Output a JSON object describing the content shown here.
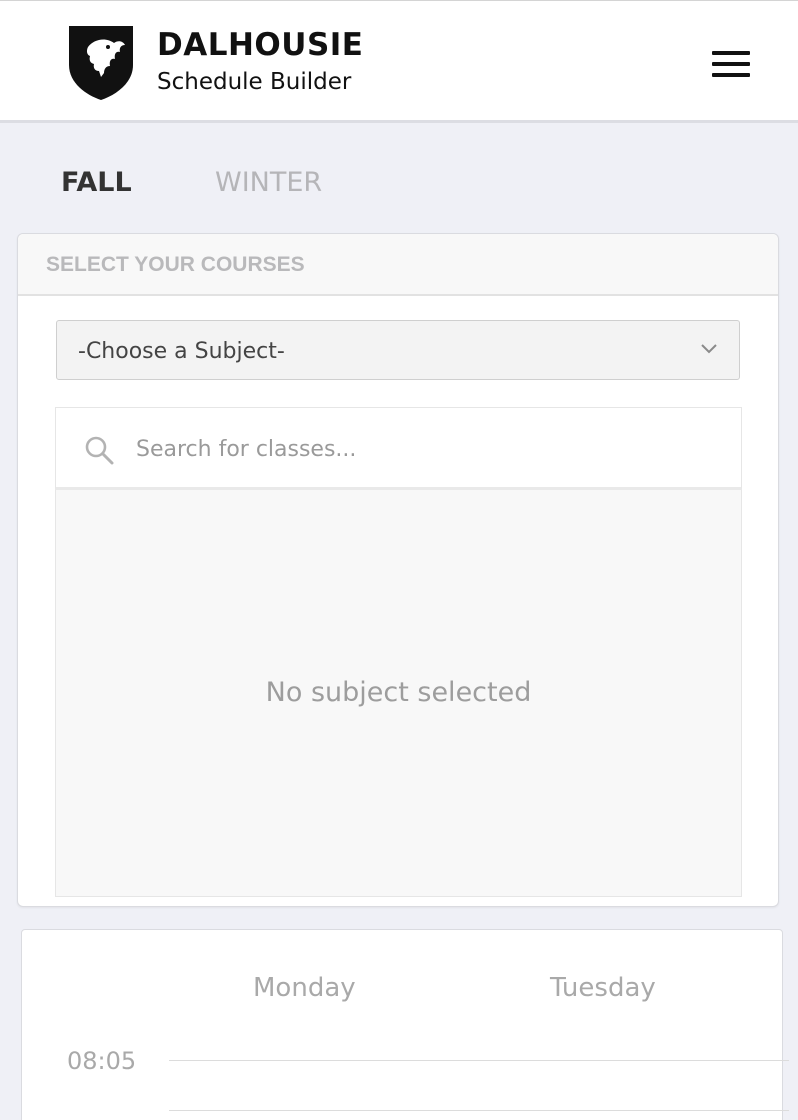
{
  "header": {
    "brand_title": "DALHOUSIE",
    "brand_subtitle": "Schedule Builder",
    "logo_icon": "shield-eagle-icon",
    "menu_icon": "hamburger-menu-icon"
  },
  "term_tabs": [
    {
      "label": "FALL",
      "active": true
    },
    {
      "label": "WINTER",
      "active": false
    }
  ],
  "course_panel": {
    "title": "SELECT YOUR COURSES",
    "subject_select": {
      "value": "-Choose a Subject-"
    },
    "search": {
      "placeholder": "Search for classes...",
      "value": ""
    },
    "empty_message": "No subject selected"
  },
  "schedule": {
    "days": [
      "Monday",
      "Tuesday"
    ],
    "times": [
      "08:05"
    ]
  },
  "colors": {
    "page_bg": "#eff0f6",
    "header_bg": "#ffffff",
    "active_tab": "#333333",
    "inactive_tab": "#b5b5b8"
  }
}
